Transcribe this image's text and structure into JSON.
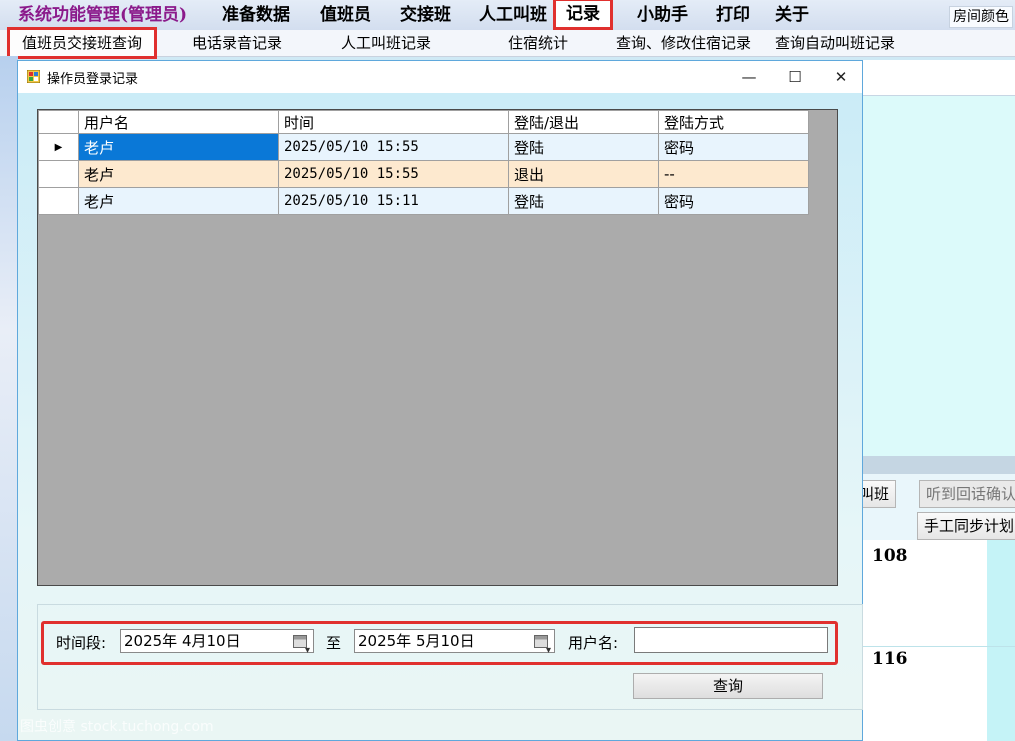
{
  "menubar": {
    "brand": "系统功能管理(管理员)",
    "items": [
      "准备数据",
      "值班员",
      "交接班",
      "人工叫班",
      "记录",
      "小助手",
      "打印",
      "关于"
    ],
    "right_label": "房间颜色"
  },
  "submenu": {
    "items": [
      "值班员交接班查询",
      "电话录音记录",
      "人工叫班记录",
      "住宿统计",
      "查询、修改住宿记录",
      "查询自动叫班记录"
    ]
  },
  "background": {
    "btn_call": "叫班",
    "btn_confirm": "听到回话确认",
    "btn_sync": "手工同步计划",
    "room_a": "108",
    "room_b": "116"
  },
  "dialog": {
    "title": "操作员登录记录",
    "columns": [
      "用户名",
      "时间",
      "登陆/退出",
      "登陆方式"
    ],
    "rows": [
      {
        "user": "老卢",
        "time": "2025/05/10 15:55",
        "action": "登陆",
        "method": "密码"
      },
      {
        "user": "老卢",
        "time": "2025/05/10 15:55",
        "action": "退出",
        "method": "--"
      },
      {
        "user": "老卢",
        "time": "2025/05/10 15:11",
        "action": "登陆",
        "method": "密码"
      }
    ],
    "filter": {
      "period_label": "时间段:",
      "date_from": "2025年  4月10日",
      "to_label": "至",
      "date_to": "2025年  5月10日",
      "user_label": "用户名:",
      "user_value": ""
    },
    "query_label": "查询"
  },
  "watermark": "图虫创意 stock.tuchong.com",
  "colors": {
    "highlight": "#e0302e",
    "selection": "#0a78d7",
    "brand": "#8b1a8b"
  },
  "icons": [
    "app-icon",
    "minimize-icon",
    "maximize-icon",
    "close-icon",
    "row-pointer-icon",
    "calendar-icon",
    "dropdown-caret-icon"
  ]
}
